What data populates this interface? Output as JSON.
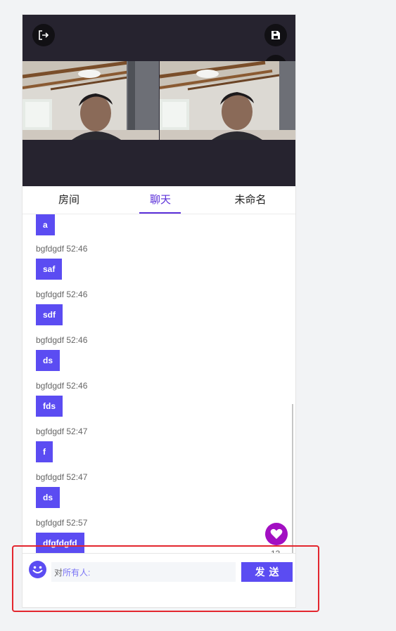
{
  "colors": {
    "accent": "#5b4cf2",
    "tab_active": "#5b2fd9",
    "video_bg": "#26232f",
    "like": "#a20fc2",
    "highlight": "#e3262e"
  },
  "toolbar": {
    "exit_icon": "exit-icon",
    "save_icon": "save-icon",
    "camera_off_icon": "camera-off-icon",
    "whiteboard_icon": "whiteboard-icon"
  },
  "tabs": [
    {
      "label": "房间",
      "active": false
    },
    {
      "label": "聊天",
      "active": true
    },
    {
      "label": "未命名",
      "active": false
    }
  ],
  "chat": {
    "messages": [
      {
        "meta": "",
        "text": "a"
      },
      {
        "meta": "bgfdgdf 52:46",
        "text": "saf"
      },
      {
        "meta": "bgfdgdf 52:46",
        "text": "sdf"
      },
      {
        "meta": "bgfdgdf 52:46",
        "text": "ds"
      },
      {
        "meta": "bgfdgdf 52:46",
        "text": "fds"
      },
      {
        "meta": "bgfdgdf 52:47",
        "text": "f"
      },
      {
        "meta": "bgfdgdf 52:47",
        "text": "ds"
      },
      {
        "meta": "bgfdgdf 52:57",
        "text": "dfgfdgfd"
      }
    ]
  },
  "like": {
    "icon": "heart-icon",
    "count": "13"
  },
  "input": {
    "emoji_icon": "smiley-icon",
    "prefix": "对",
    "target": "所有人:",
    "value": ""
  },
  "send": {
    "label": "发送"
  }
}
